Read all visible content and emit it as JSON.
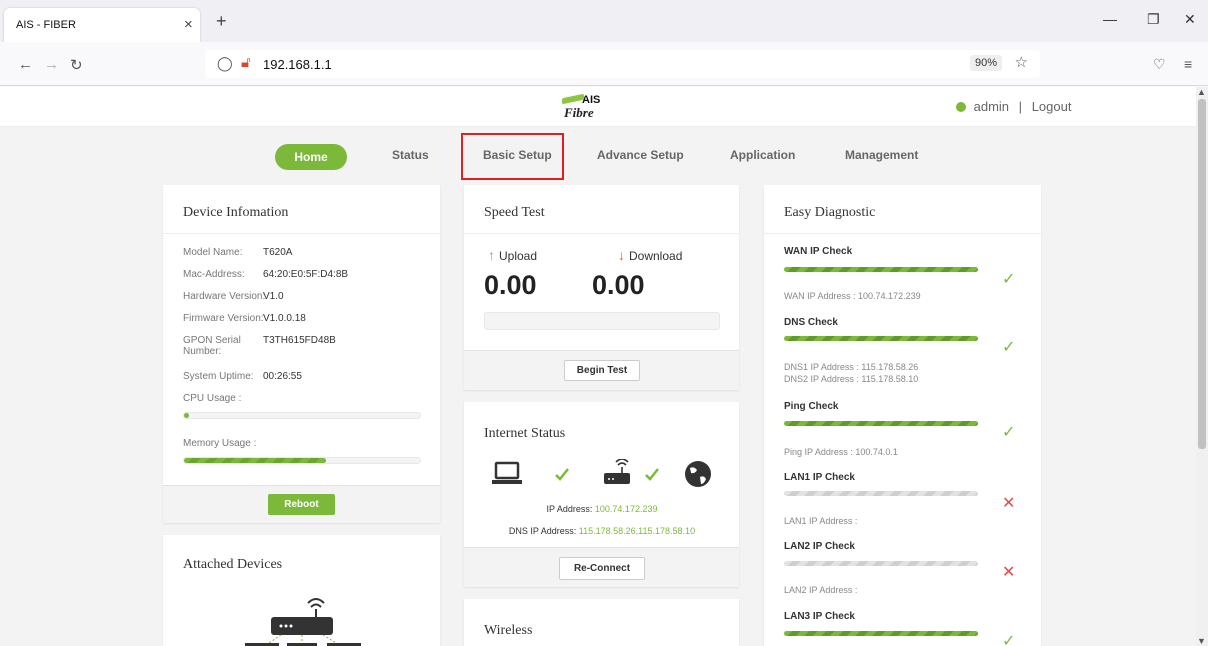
{
  "browser": {
    "tab_title": "AIS - FIBER",
    "url": "192.168.1.1",
    "zoom": "90%"
  },
  "header": {
    "logo_top": "AIS",
    "logo_bottom": "Fibre",
    "user": "admin",
    "separator": "|",
    "logout": "Logout"
  },
  "menu": {
    "home": "Home",
    "status": "Status",
    "basic_setup": "Basic Setup",
    "advance_setup": "Advance Setup",
    "application": "Application",
    "management": "Management"
  },
  "device": {
    "title": "Device Infomation",
    "rows": [
      {
        "label": "Model Name:",
        "value": "T620A"
      },
      {
        "label": "Mac-Address:",
        "value": "64:20:E0:5F:D4:8B"
      },
      {
        "label": "Hardware Version:",
        "value": "V1.0"
      },
      {
        "label": "Firmware Version:",
        "value": "V1.0.0.18"
      },
      {
        "label": "GPON Serial Number:",
        "value": "T3TH615FD48B"
      },
      {
        "label": "System Uptime:",
        "value": "00:26:55"
      }
    ],
    "cpu_label": "CPU Usage :",
    "cpu_usage": 0.02,
    "memory_label": "Memory Usage :",
    "memory_usage": 0.6,
    "reboot": "Reboot"
  },
  "attached": {
    "title": "Attached Devices"
  },
  "speed": {
    "title": "Speed Test",
    "upload_label": "Upload",
    "download_label": "Download",
    "upload_value": "0.00",
    "download_value": "0.00",
    "begin": "Begin Test"
  },
  "internet": {
    "title": "Internet Status",
    "ip_label": "IP Address:",
    "ip_value": "100.74.172.239",
    "dns_label": "DNS IP Address:",
    "dns_value": "115.178.58.26,115.178.58.10",
    "reconnect": "Re-Connect"
  },
  "wireless": {
    "title": "Wireless"
  },
  "diagnostic": {
    "title": "Easy Diagnostic",
    "wan_title": "WAN IP Check",
    "wan_info": "WAN IP Address : 100.74.172.239",
    "dns_title": "DNS Check",
    "dns_info1": "DNS1 IP Address : 115.178.58.26",
    "dns_info2": "DNS2 IP Address : 115.178.58.10",
    "ping_title": "Ping Check",
    "ping_info": "Ping IP Address : 100.74.0.1",
    "lan1_title": "LAN1 IP Check",
    "lan1_info": "LAN1 IP Address :",
    "lan2_title": "LAN2 IP Check",
    "lan2_info": "LAN2 IP Address :",
    "lan3_title": "LAN3 IP Check"
  }
}
